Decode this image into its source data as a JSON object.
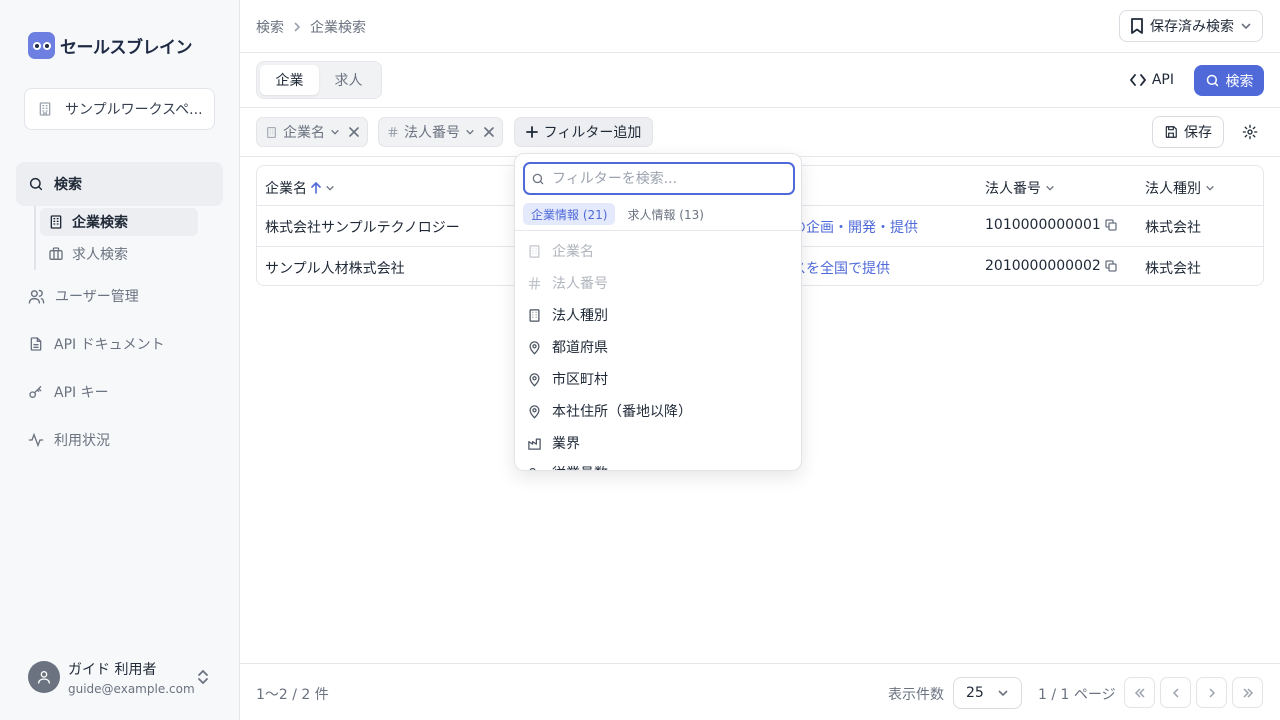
{
  "sidebar": {
    "logo_text": "セールスブレイン",
    "workspace": "サンプルワークスペ...",
    "nav": {
      "search": "検索",
      "company_search": "企業検索",
      "job_search": "求人検索",
      "users": "ユーザー管理",
      "api_docs": "API ドキュメント",
      "api_keys": "API キー",
      "usage": "利用状況"
    },
    "user": {
      "name": "ガイド 利用者",
      "email": "guide@example.com"
    }
  },
  "header": {
    "breadcrumb": [
      "検索",
      "企業検索"
    ],
    "saved_searches": "保存済み検索"
  },
  "toolbar": {
    "tabs": [
      "企業",
      "求人"
    ],
    "api_label": "API",
    "search_label": "検索"
  },
  "filters": {
    "chips": [
      "企業名",
      "法人番号"
    ],
    "add_filter": "フィルター追加",
    "save_label": "保存"
  },
  "table": {
    "columns": [
      "企業名",
      "",
      "法人番号",
      "法人種別"
    ],
    "rows": [
      {
        "name": "株式会社サンプルテクノロジー",
        "desc_fragment": "の企画・開発・提供",
        "corp_number": "1010000000001",
        "corp_type": "株式会社"
      },
      {
        "name": "サンプル人材株式会社",
        "desc_fragment": "スを全国で提供",
        "corp_number": "2010000000002",
        "corp_type": "株式会社"
      }
    ]
  },
  "footer": {
    "count": "1〜2 / 2 件",
    "per_page_label": "表示件数",
    "per_page_value": "25",
    "page_info": "1 / 1 ページ"
  },
  "dropdown": {
    "search_placeholder": "フィルターを検索...",
    "tabs": [
      "企業情報 (21)",
      "求人情報 (13)"
    ],
    "items": [
      {
        "label": "企業名",
        "icon": "building-icon",
        "disabled": true
      },
      {
        "label": "法人番号",
        "icon": "hash-icon",
        "disabled": true
      },
      {
        "label": "法人種別",
        "icon": "building-icon",
        "disabled": false
      },
      {
        "label": "都道府県",
        "icon": "map-pin-icon",
        "disabled": false
      },
      {
        "label": "市区町村",
        "icon": "map-pin-icon",
        "disabled": false
      },
      {
        "label": "本社住所（番地以降）",
        "icon": "map-pin-icon",
        "disabled": false
      },
      {
        "label": "業界",
        "icon": "factory-icon",
        "disabled": false
      },
      {
        "label": "従業員数",
        "icon": "users-icon",
        "disabled": false
      }
    ]
  },
  "colors": {
    "accent": "#4f6ad8",
    "sidebar_bg": "#f7f8fa"
  }
}
